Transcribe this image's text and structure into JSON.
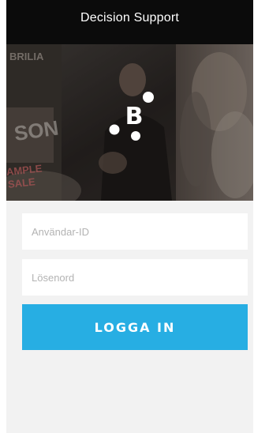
{
  "app": {
    "title": "Decision Support"
  },
  "hero": {
    "logo_letter": "B",
    "background_signs": [
      "BRILIA",
      "SON",
      "AMPLE",
      "SALE"
    ]
  },
  "login": {
    "username_placeholder": "Användar-ID",
    "password_placeholder": "Lösenord",
    "submit_label": "LOGGA IN"
  },
  "colors": {
    "header_bg": "#0b0b0b",
    "button_bg": "#27aee3",
    "form_bg": "#f2f2f2"
  }
}
